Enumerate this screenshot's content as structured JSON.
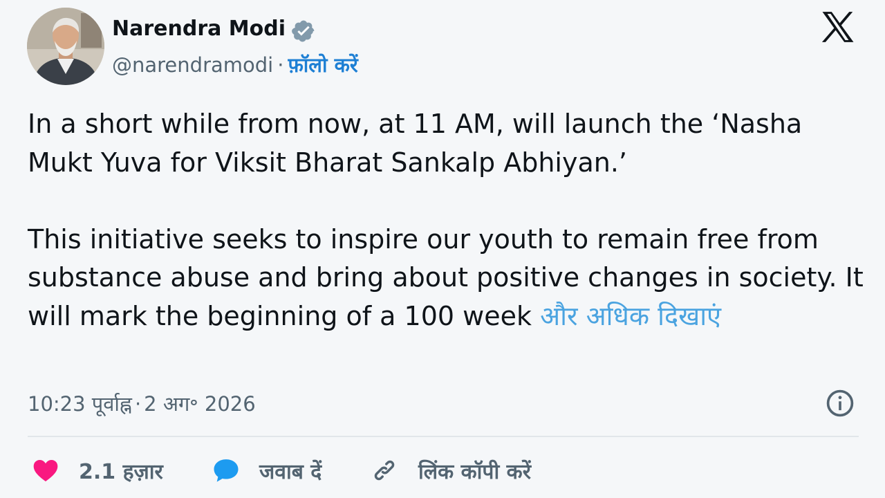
{
  "author": {
    "name": "Narendra Modi",
    "handle": "@narendramodi",
    "separator": "·",
    "follow_label": "फ़ॉलो करें",
    "verified_icon": "verified-badge-icon"
  },
  "platform": {
    "logo_icon": "x-logo-icon"
  },
  "tweet": {
    "paragraph1": "In a short while from now, at 11 AM, will launch the ‘Nasha Mukt Yuva for Viksit Bharat Sankalp Abhiyan.’",
    "paragraph2": "This initiative seeks to inspire our youth to remain free from substance abuse and bring about positive changes in society. It will mark the beginning of a 100 week",
    "show_more_label": "और अधिक दिखाएं"
  },
  "meta": {
    "time": "10:23 पूर्वाह्न",
    "separator": "·",
    "date": "2 अग॰ 2026",
    "info_icon": "info-icon"
  },
  "actions": {
    "like_count": "2.1 हज़ार",
    "reply_label": "जवाब दें",
    "copy_link_label": "लिंक कॉपी करें"
  },
  "colors": {
    "accent": "#1d9bf0",
    "like": "#f91880",
    "muted_text": "#536471"
  }
}
